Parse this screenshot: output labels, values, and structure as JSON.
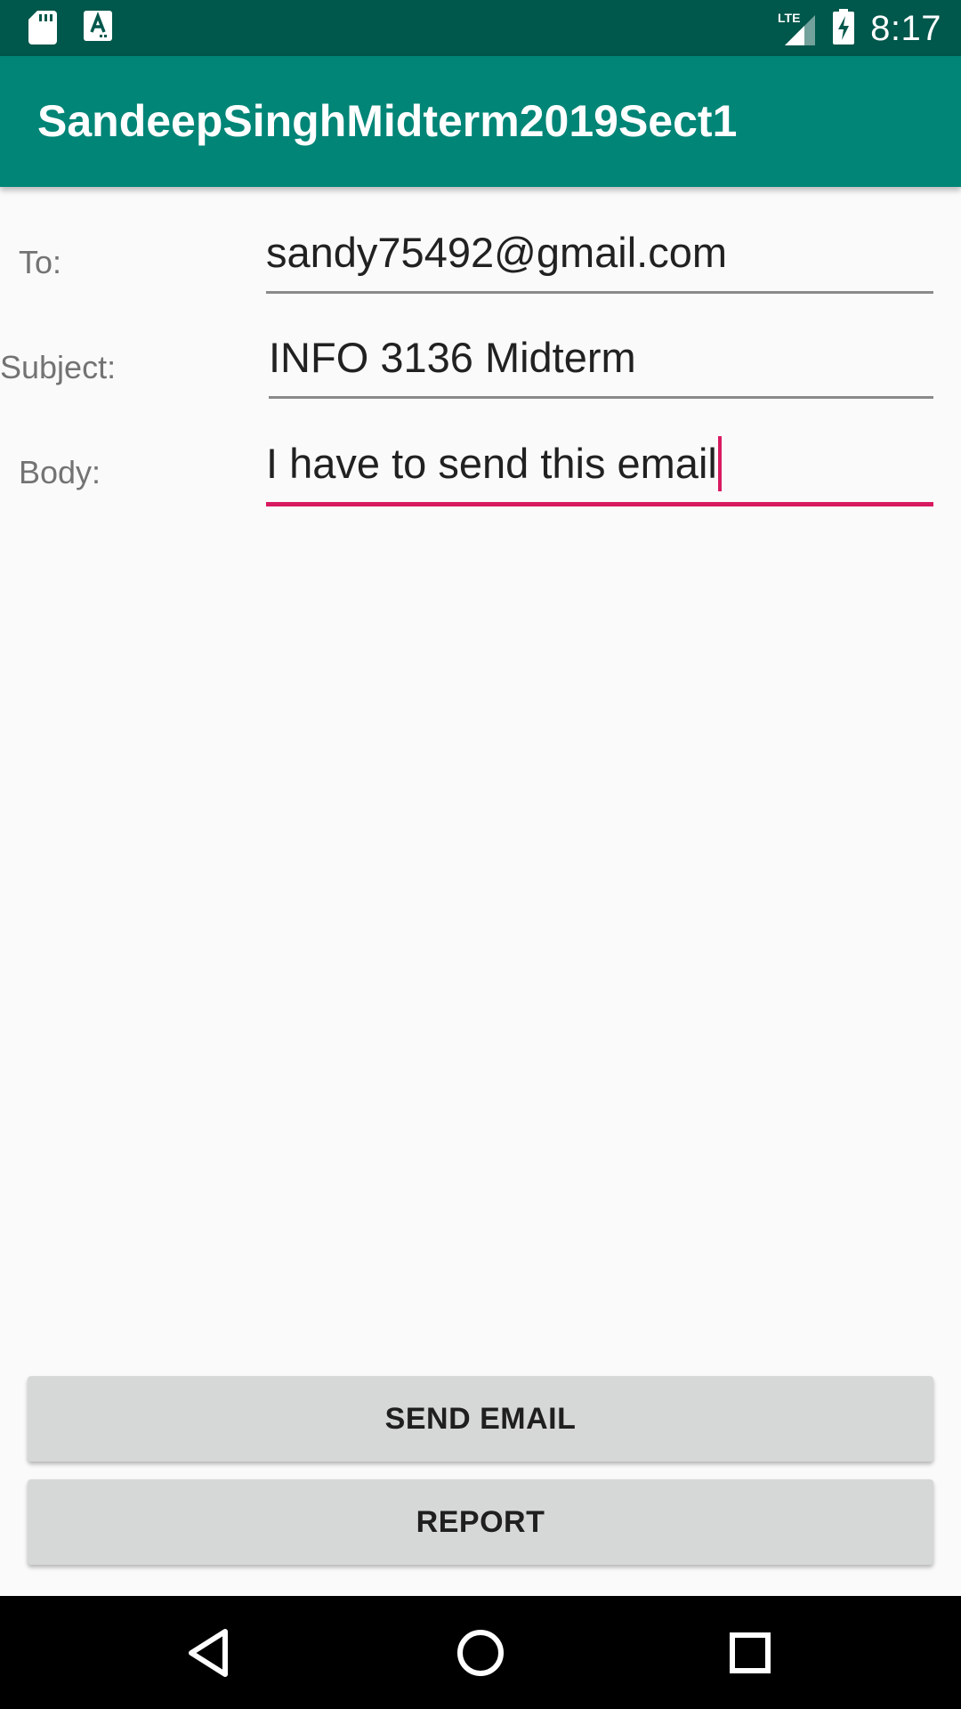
{
  "status_bar": {
    "time": "8:17",
    "network_label": "LTE",
    "icons": [
      "sd-card-icon",
      "text-a-icon",
      "signal-icon",
      "battery-charging-icon"
    ]
  },
  "app_bar": {
    "title": "SandeepSinghMidterm2019Sect1"
  },
  "form": {
    "to_label": "To:",
    "to_value": "sandy75492@gmail.com",
    "subject_label": "Subject:",
    "subject_value": "INFO 3136 Midterm",
    "body_label": "Body:",
    "body_value": "I have to send this email"
  },
  "buttons": {
    "send_email": "SEND EMAIL",
    "report": "REPORT"
  },
  "nav_bar": {
    "icons": [
      "back-icon",
      "home-icon",
      "recents-icon"
    ]
  },
  "colors": {
    "status_bar": "#00574b",
    "app_bar": "#008577",
    "accent": "#d81b60",
    "button": "#d6d7d7"
  }
}
